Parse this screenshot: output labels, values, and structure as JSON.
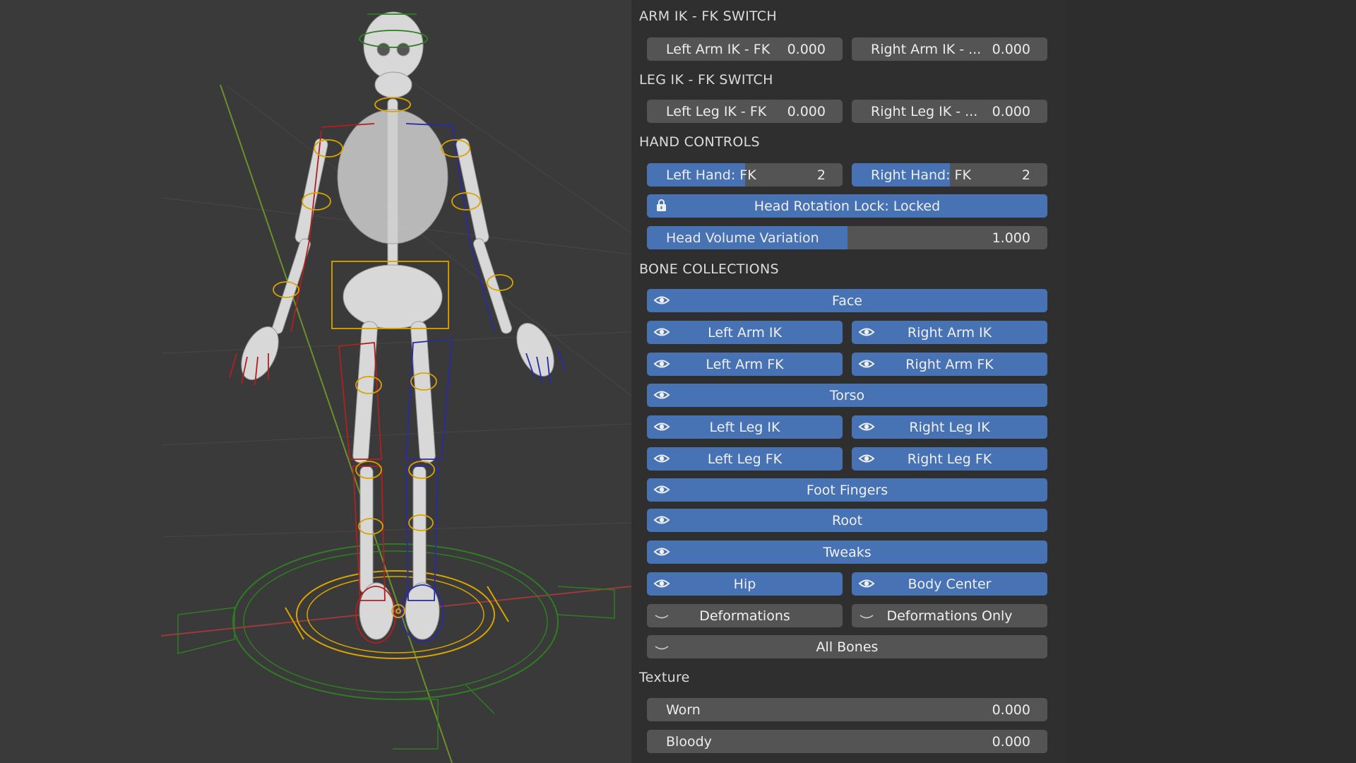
{
  "arm_switch": {
    "title": "ARM IK - FK SWITCH",
    "left": {
      "label": "Left Arm IK - FK",
      "value": "0.000"
    },
    "right": {
      "label": "Right Arm IK - ...",
      "value": "0.000"
    }
  },
  "leg_switch": {
    "title": "LEG IK - FK SWITCH",
    "left": {
      "label": "Left Leg IK - FK",
      "value": "0.000"
    },
    "right": {
      "label": "Right Leg IK - ...",
      "value": "0.000"
    }
  },
  "hand_controls": {
    "title": "HAND CONTROLS",
    "left_hand": {
      "label": "Left Hand: FK",
      "value": "2",
      "fill_fraction": 0.5
    },
    "right_hand": {
      "label": "Right Hand: FK",
      "value": "2",
      "fill_fraction": 0.5
    },
    "head_lock": {
      "label": "Head Rotation Lock: Locked",
      "icon": "lock-icon"
    },
    "head_volume": {
      "label": "Head Volume Variation",
      "value": "1.000",
      "fill_fraction": 0.5
    }
  },
  "bone_collections": {
    "title": "BONE COLLECTIONS",
    "items": {
      "face": "Face",
      "left_arm_ik": "Left Arm IK",
      "right_arm_ik": "Right Arm IK",
      "left_arm_fk": "Left Arm FK",
      "right_arm_fk": "Right Arm FK",
      "torso": "Torso",
      "left_leg_ik": "Left Leg IK",
      "right_leg_ik": "Right Leg IK",
      "left_leg_fk": "Left Leg FK",
      "right_leg_fk": "Right Leg FK",
      "foot_fingers": "Foot Fingers",
      "root": "Root",
      "tweaks": "Tweaks",
      "hip": "Hip",
      "body_center": "Body Center",
      "deformations": "Deformations",
      "deformations_only": "Deformations Only",
      "all_bones": "All Bones"
    },
    "visible_icon": "eye-icon",
    "hidden_icon": "eye-closed-icon"
  },
  "texture": {
    "title": "Texture",
    "worn": {
      "label": "Worn",
      "value": "0.000"
    },
    "bloody": {
      "label": "Bloody",
      "value": "0.000"
    }
  },
  "colors": {
    "accent": "#4772b3",
    "field": "#545454",
    "panel_bg": "#2f2f2f",
    "viewport_bg": "#3a3a3a",
    "rig_red": "#b02020",
    "rig_blue": "#2a2aa8",
    "rig_yellow": "#d9a400",
    "rig_green": "#2e7d22"
  }
}
